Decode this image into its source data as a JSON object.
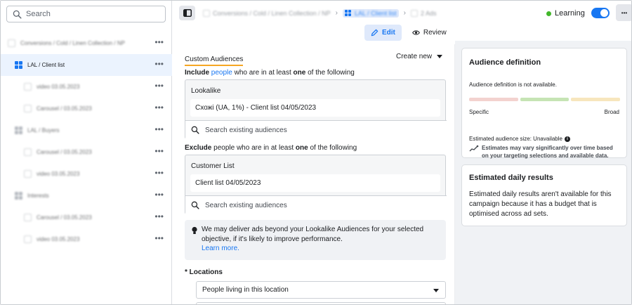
{
  "sidebar": {
    "search_placeholder": "Search",
    "items": [
      {
        "label": "Conversions / Cold / Linen Collection / NP",
        "level": "campaign",
        "blurred": true
      },
      {
        "label": "LAL / Client list",
        "level": "adset",
        "blurred": false,
        "selected": true
      },
      {
        "label": "video 03.05.2023",
        "level": "ad",
        "blurred": true
      },
      {
        "label": "Carousel / 03.05.2023",
        "level": "ad",
        "blurred": true
      },
      {
        "label": "LAL / Buyers",
        "level": "adset",
        "blurred": true
      },
      {
        "label": "Carousel / 03.05.2023",
        "level": "ad",
        "blurred": true
      },
      {
        "label": "video 03.05.2023",
        "level": "ad",
        "blurred": true
      },
      {
        "label": "Interests",
        "level": "adset",
        "blurred": true
      },
      {
        "label": "Carousel / 03.05.2023",
        "level": "ad",
        "blurred": true
      },
      {
        "label": "video 03.05.2023",
        "level": "ad",
        "blurred": true
      }
    ],
    "more_label": "•••"
  },
  "topbar": {
    "breadcrumbs": [
      "Conversions / Cold / Linen Collection / NP",
      "LAL / Client list",
      "2 Ads"
    ],
    "status": "Learning",
    "more_label": "•••"
  },
  "tabs": [
    {
      "label": "Edit",
      "active": true
    },
    {
      "label": "Review",
      "active": false
    }
  ],
  "main": {
    "custom_audiences_title": "Custom Audiences",
    "create_new": "Create new",
    "include": {
      "prefix": "Include",
      "link": "people",
      "middle": " who are in at least ",
      "bold": "one",
      "suffix": " of the following"
    },
    "include_box": {
      "title": "Lookalike",
      "value": "Схожі (UA, 1%) - Client list 04/05/2023",
      "search_placeholder": "Search existing audiences"
    },
    "exclude": {
      "prefix": "Exclude",
      "middle": " people who are in at least ",
      "bold": "one",
      "suffix": " of the following"
    },
    "exclude_box": {
      "title": "Customer List",
      "value": "Client list 04/05/2023",
      "search_placeholder": "Search existing audiences"
    },
    "notice": {
      "text": "We may deliver ads beyond your Lookalike Audiences for your selected objective, if it's likely to improve performance.",
      "link": "Learn more."
    },
    "locations_label": "* Locations",
    "locations_dropdown": "People living in this location"
  },
  "audience_definition": {
    "title": "Audience definition",
    "unavailable": "Audience definition is not available.",
    "specific": "Specific",
    "broad": "Broad",
    "estimated_size": "Estimated audience size: Unavailable",
    "estimated_note": "Estimates may vary significantly over time based on your targeting selections and available data.",
    "meter_colors": [
      "#f3d2cf",
      "#c6e4b4",
      "#f7e6bd"
    ]
  },
  "daily_results": {
    "title": "Estimated daily results",
    "body": "Estimated daily results aren't available for this campaign because it has a budget that is optimised across ad sets."
  },
  "colors": {
    "accent": "#1877f2",
    "learning": "#42b72a",
    "underline": "#f5a623"
  }
}
